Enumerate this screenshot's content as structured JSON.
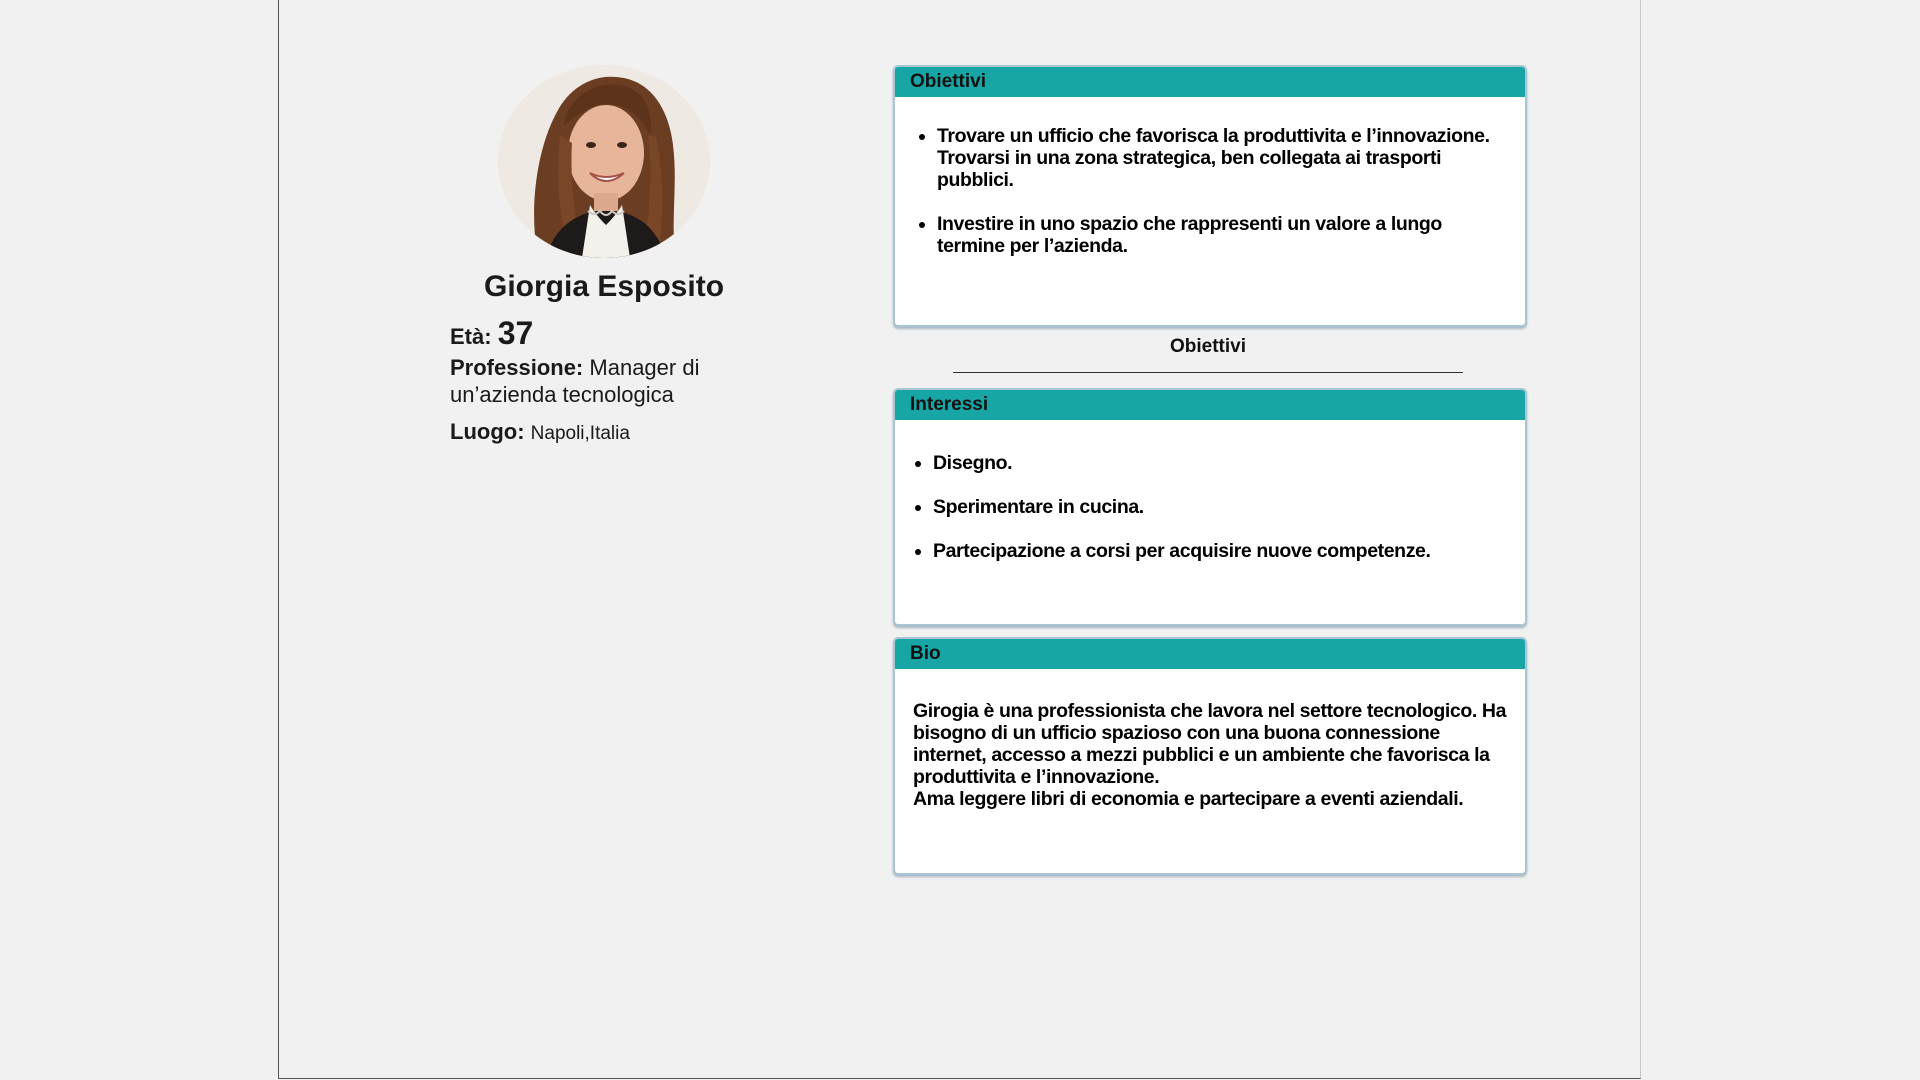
{
  "profile": {
    "name": "Giorgia Esposito",
    "age_label": "Età:",
    "age_value": "37",
    "job_label": "Professione:",
    "job_value": "Manager di un’azienda tecnologica",
    "location_label": "Luogo:",
    "location_value": "Napoli,Italia"
  },
  "goals_card": {
    "title": "Obiettivi",
    "items": [
      "Trovare un ufficio che favorisca la produttivita e l’innovazione. Trovarsi in una zona strategica, ben collegata ai trasporti pubblici.",
      "Investire in uno spazio che rappresenti un valore a lungo termine per l’azienda."
    ]
  },
  "section_caption": "Obiettivi",
  "interests_card": {
    "title": "Interessi",
    "items": [
      "Disegno.",
      "Sperimentare in cucina.",
      "Partecipazione a corsi per acquisire nuove competenze."
    ]
  },
  "bio_card": {
    "title": "Bio",
    "text_line1": "Girogia è una professionista che lavora nel settore tecnologico. Ha bisogno di un ufficio spazioso con una buona connessione internet, accesso a mezzi pubblici e un ambiente che favorisca la produttivita e l’innovazione.",
    "text_line2": "Ama leggere libri di economia e partecipare a eventi aziendali."
  },
  "colors": {
    "header_teal": "#17a5a6",
    "background": "#f1f1f1",
    "card_border": "#a8c6d4"
  }
}
